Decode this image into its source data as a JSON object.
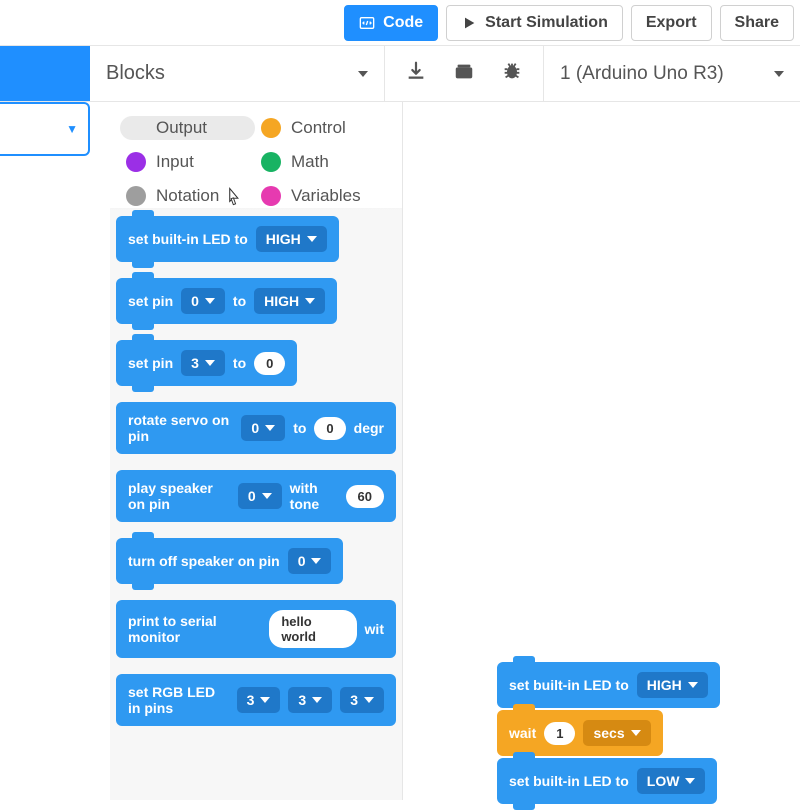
{
  "toolbar": {
    "code": "Code",
    "start_sim": "Start Simulation",
    "export": "Export",
    "share": "Share"
  },
  "secondbar": {
    "mode": "Blocks",
    "board": "1 (Arduino Uno R3)"
  },
  "categories": {
    "output": "Output",
    "input": "Input",
    "notation": "Notation",
    "control": "Control",
    "math": "Math",
    "variables": "Variables",
    "colors": {
      "output": "#2f99f1",
      "input": "#9b2fe6",
      "notation": "#9e9e9e",
      "control": "#f5a623",
      "math": "#18b363",
      "variables": "#e63ab0"
    }
  },
  "palette": {
    "b1": {
      "text": "set built-in LED to",
      "val": "HIGH"
    },
    "b2": {
      "t1": "set pin",
      "pin": "0",
      "t2": "to",
      "val": "HIGH"
    },
    "b3": {
      "t1": "set pin",
      "pin": "3",
      "t2": "to",
      "val": "0"
    },
    "b4": {
      "t1": "rotate servo on pin",
      "pin": "0",
      "t2": "to",
      "val": "0",
      "t3": "degr"
    },
    "b5": {
      "t1": "play speaker on pin",
      "pin": "0",
      "t2": "with tone",
      "val": "60"
    },
    "b6": {
      "t1": "turn off speaker on pin",
      "pin": "0"
    },
    "b7": {
      "t1": "print to serial monitor",
      "val": "hello world",
      "t2": "wit"
    },
    "b8": {
      "t1": "set RGB LED in pins",
      "p1": "3",
      "p2": "3",
      "p3": "3"
    }
  },
  "workspace": {
    "s1": {
      "text": "set built-in LED to",
      "val": "HIGH"
    },
    "s2": {
      "t1": "wait",
      "val": "1",
      "unit": "secs"
    },
    "s3": {
      "text": "set built-in LED to",
      "val": "LOW"
    }
  }
}
